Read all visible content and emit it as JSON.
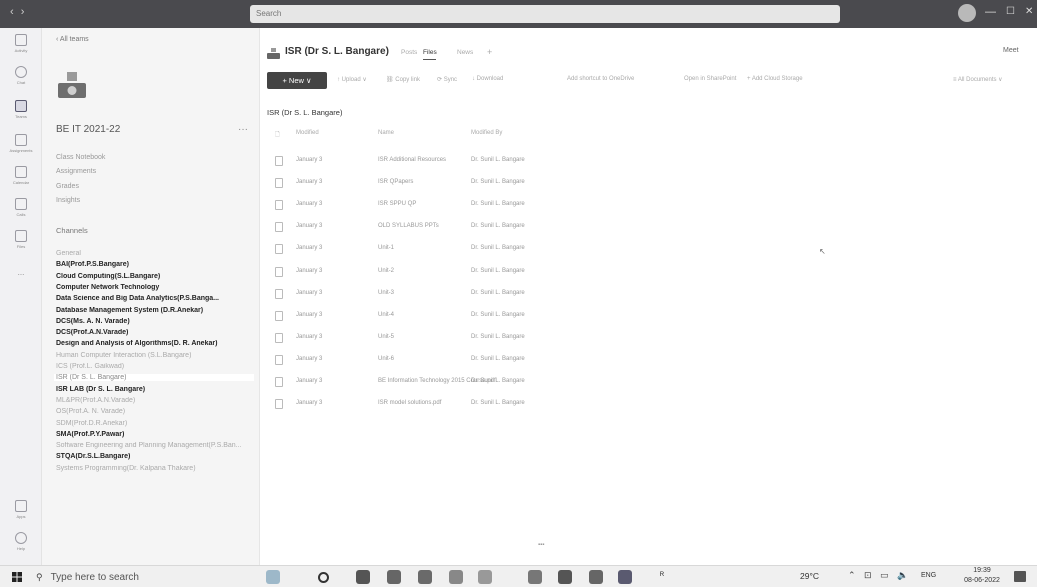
{
  "window": {
    "search_placeholder": "Search",
    "nav": "‹ ›"
  },
  "rail": {
    "items": [
      "Activity",
      "Chat",
      "Teams",
      "Assignments",
      "Calendar",
      "Calls",
      "Files",
      "..."
    ],
    "bottom_items": [
      "Apps",
      "Help"
    ]
  },
  "sidebar": {
    "back_label": "‹ All teams",
    "team_name": "BE IT 2021-22",
    "more": "···",
    "links": [
      "Class Notebook",
      "Assignments",
      "Grades",
      "Insights"
    ],
    "channels_heading": "Channels",
    "channels": [
      {
        "label": "General",
        "bold": false
      },
      {
        "label": "BAI(Prof.P.S.Bangare)",
        "bold": true
      },
      {
        "label": "Cloud Computing(S.L.Bangare)",
        "bold": true
      },
      {
        "label": "Computer Network Technology",
        "bold": true
      },
      {
        "label": "Data Science and Big Data Analytics(P.S.Banga...",
        "bold": true
      },
      {
        "label": "Database Management System (D.R.Anekar)",
        "bold": true
      },
      {
        "label": "DCS(Ms. A. N. Varade)",
        "bold": true
      },
      {
        "label": "DCS(Prof.A.N.Varade)",
        "bold": true
      },
      {
        "label": "Design and Analysis of Algorithms(D. R. Anekar)",
        "bold": true
      },
      {
        "label": "Human Computer Interaction (S.L.Bangare)",
        "bold": false
      },
      {
        "label": "ICS (Prof.L. Gaikwad)",
        "bold": false
      },
      {
        "label": "ISR (Dr S. L. Bangare)",
        "bold": false,
        "selected": true
      },
      {
        "label": "ISR LAB (Dr S. L. Bangare)",
        "bold": true
      },
      {
        "label": "ML&PR(Prof.A.N.Varade)",
        "bold": false
      },
      {
        "label": "OS(Prof.A. N. Varade)",
        "bold": false
      },
      {
        "label": "SDM(Prof.D.R.Anekar)",
        "bold": false
      },
      {
        "label": "SMA(Prof.P.Y.Pawar)",
        "bold": true
      },
      {
        "label": "Software Engineering and Planning Management(P.S.Ban...",
        "bold": false
      },
      {
        "label": "STQA(Dr.S.L.Bangare)",
        "bold": true
      },
      {
        "label": "Systems Programming(Dr. Kalpana Thakare)",
        "bold": false
      }
    ]
  },
  "main": {
    "channel_title": "ISR (Dr S. L. Bangare)",
    "tabs": {
      "posts": "Posts",
      "files": "Files",
      "news": "News",
      "add": "+"
    },
    "meet": "Meet",
    "new_button": "+ New ∨",
    "toolbar": {
      "upload": "↑ Upload ∨",
      "copy_link": "⛓ Copy link",
      "sync": "⟳ Sync",
      "download": "↓ Download",
      "shortcut": "Add shortcut to OneDrive",
      "sharepoint": "Open in SharePoint",
      "cloud": "+ Add Cloud Storage",
      "all_docs": "≡ All Documents ∨"
    },
    "breadcrumb": "ISR (Dr S. L. Bangare)",
    "columns": {
      "modified": "Modified",
      "name": "Name",
      "modified_by": "Modified By"
    },
    "files": [
      {
        "modified": "January 3",
        "name": "ISR Additional Resources",
        "by": "Dr. Sunil L. Bangare"
      },
      {
        "modified": "January 3",
        "name": "ISR QPapers",
        "by": "Dr. Sunil L. Bangare"
      },
      {
        "modified": "January 3",
        "name": "ISR SPPU QP",
        "by": "Dr. Sunil L. Bangare"
      },
      {
        "modified": "January 3",
        "name": "OLD SYLLABUS PPTs",
        "by": "Dr. Sunil L. Bangare"
      },
      {
        "modified": "January 3",
        "name": "Unit-1",
        "by": "Dr. Sunil L. Bangare"
      },
      {
        "modified": "January 3",
        "name": "Unit-2",
        "by": "Dr. Sunil L. Bangare"
      },
      {
        "modified": "January 3",
        "name": "Unit-3",
        "by": "Dr. Sunil L. Bangare"
      },
      {
        "modified": "January 3",
        "name": "Unit-4",
        "by": "Dr. Sunil L. Bangare"
      },
      {
        "modified": "January 3",
        "name": "Unit-5",
        "by": "Dr. Sunil L. Bangare"
      },
      {
        "modified": "January 3",
        "name": "Unit-6",
        "by": "Dr. Sunil L. Bangare"
      },
      {
        "modified": "January 3",
        "name": "BE Information Technology 2015 Course.pdf",
        "by": "Dr. Sunil L. Bangare"
      },
      {
        "modified": "January 3",
        "name": "ISR model solutions.pdf",
        "by": "Dr. Sunil L. Bangare"
      }
    ]
  },
  "taskbar": {
    "search_placeholder": "Type here to search",
    "weather": "29°C",
    "lang": "ENG",
    "time": "19:39",
    "date": "08-06-2022"
  }
}
